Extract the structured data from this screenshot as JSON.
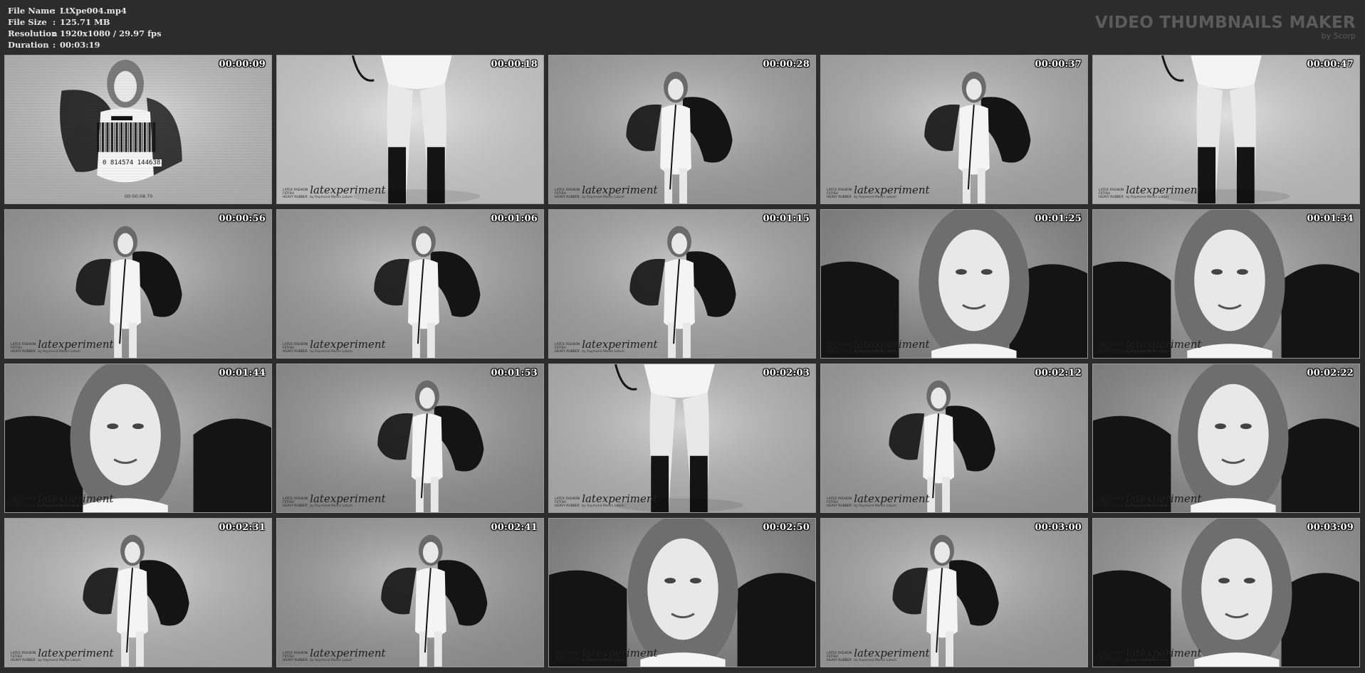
{
  "info": {
    "rows": [
      {
        "key": "File Name",
        "value": "LtXpe004.mp4"
      },
      {
        "key": "File Size",
        "value": "125.71 MB"
      },
      {
        "key": "Resolution",
        "value": "1920x1080 / 29.97 fps"
      },
      {
        "key": "Duration",
        "value": "00:03:19"
      }
    ]
  },
  "brand": {
    "title": "VIDEO THUMBNAILS MAKER",
    "subtitle": "by Scorp"
  },
  "watermark": {
    "small_lines": [
      "LATEX FASHION",
      "FETISH",
      "HEAVY RUBBER"
    ],
    "logo": "latexperiment",
    "sub": "by Raymond Martin Latum"
  },
  "first_frame": {
    "barcode_digits": "0 814574 144638",
    "timecode": "00:00:08.70"
  },
  "thumbnails": [
    {
      "time": "00:00:09",
      "tone": "#c9c9c9",
      "scene": "barcode"
    },
    {
      "time": "00:00:18",
      "tone": "#d8d8d8",
      "scene": "legs"
    },
    {
      "time": "00:00:28",
      "tone": "#a8a8a8",
      "scene": "figure"
    },
    {
      "time": "00:00:37",
      "tone": "#b4b4b4",
      "scene": "figure"
    },
    {
      "time": "00:00:47",
      "tone": "#cfcfcf",
      "scene": "legs"
    },
    {
      "time": "00:00:56",
      "tone": "#a0a0a0",
      "scene": "figure"
    },
    {
      "time": "00:01:06",
      "tone": "#a4a4a4",
      "scene": "figure"
    },
    {
      "time": "00:01:15",
      "tone": "#acacac",
      "scene": "figure"
    },
    {
      "time": "00:01:25",
      "tone": "#8c8c8c",
      "scene": "closeup"
    },
    {
      "time": "00:01:34",
      "tone": "#9a9a9a",
      "scene": "closeup"
    },
    {
      "time": "00:01:44",
      "tone": "#9c9c9c",
      "scene": "closeup"
    },
    {
      "time": "00:01:53",
      "tone": "#999999",
      "scene": "figure"
    },
    {
      "time": "00:02:03",
      "tone": "#bdbdbd",
      "scene": "legs"
    },
    {
      "time": "00:02:12",
      "tone": "#a6a6a6",
      "scene": "figure"
    },
    {
      "time": "00:02:22",
      "tone": "#8e8e8e",
      "scene": "closeup"
    },
    {
      "time": "00:02:31",
      "tone": "#bcbcbc",
      "scene": "figure"
    },
    {
      "time": "00:02:41",
      "tone": "#9e9e9e",
      "scene": "figure"
    },
    {
      "time": "00:02:50",
      "tone": "#8a8a8a",
      "scene": "closeup"
    },
    {
      "time": "00:03:00",
      "tone": "#aaaaaa",
      "scene": "figure"
    },
    {
      "time": "00:03:09",
      "tone": "#9a9a9a",
      "scene": "closeup"
    }
  ]
}
